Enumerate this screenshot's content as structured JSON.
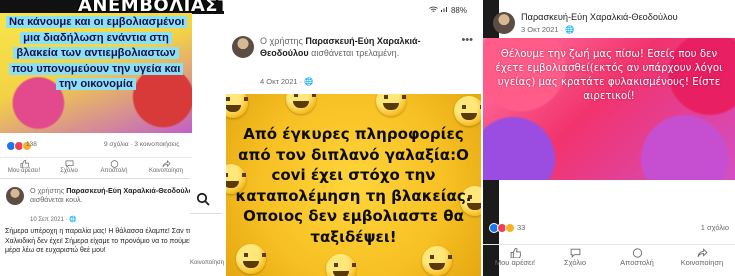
{
  "banner": {
    "title": "ΑΝΕΜΒΟΛΙΑΣΤΟΥΣ!"
  },
  "post_left_top": {
    "image_text": "Να κάνουμε και οι εμβολιασμένοι μια διαδήλωση ενάντια στη βλακεία των αντιεμβολιαστων που υπονομεύουν την υγεία και την οικονομία",
    "reactions_count": "138",
    "comments_shares": "9 σχόλια · 3 κοινοποιήσεις",
    "actions": [
      "Μου αρέσει!",
      "Σχόλιο",
      "Αποστολή",
      "Κοινοποίηση"
    ]
  },
  "post_left_bottom": {
    "prefix": "Ο χρήστης",
    "author": "Παρασκευή-Εύη Χαραλκιά-Θεοδούλου",
    "emoji": "😎",
    "feeling": "αισθάνεται κουλ.",
    "date": "10 Σεπ 2021 · 🌐",
    "body": "Σήμερα υπέροχη η παραλία μας! Η θάλασσα έλαμπε! Σαν την Χαλκιδική δεν έχει! Σήμερα είχαμε το προνόμιο να το πούμε! Κάθε μέρα λέω σε ευχαριστώ θεέ μου!",
    "side_action": "Κοινοποίηση"
  },
  "post_center": {
    "status_time": "",
    "battery": "88%",
    "prefix": "Ο χρήστης",
    "author": "Παρασκευή-Εύη Χαραλκιά-Θεοδούλου",
    "feeling": "αισθάνεται τρελαμένη.",
    "date": "4 Οκτ 2021 · 🌐",
    "more": "•••",
    "image_text": "Από έγκυρες πληροφορίες από τον διπλανό γαλαξία:Ο covi έχει στόχο την καταπολέμηση τη βλακείας. Οποιος δεν εμβολιαστε θα ταξιδέψει!"
  },
  "post_right": {
    "author": "Παρασκευή-Εύη Χαραλκιά-Θεοδούλου",
    "date": "3 Οκτ 2021 · 🌐",
    "image_text": "Θέλουμε την ζωή μας πίσω! Εσείς που δεν έχετε εμβολιασθεί(εκτός αν υπάρχουν λόγοι υγείας) μας κρατάτε φυλακισμένους! Είστε αιρετικοί!",
    "reactions_count": "33",
    "comments": "1 σχόλιο",
    "actions": [
      "Μου αρέσει!",
      "Σχόλιο",
      "Αποστολή",
      "Κοινοποίηση"
    ]
  },
  "colors": {
    "facebook_blue": "#1877f2",
    "meta_gray": "#65676b"
  }
}
